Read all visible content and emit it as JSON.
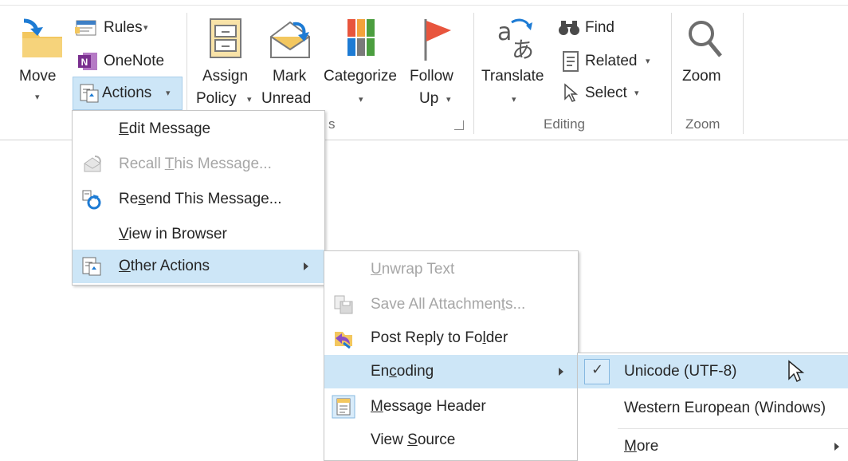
{
  "ribbon": {
    "move": {
      "label": "Move",
      "arrow": "▾",
      "icon": "move-folder-icon"
    },
    "rules": {
      "label": "Rules",
      "arrow": "▾",
      "icon": "rules-icon"
    },
    "onenote": {
      "label": "OneNote",
      "icon": "onenote-icon"
    },
    "actions": {
      "label": "Actions",
      "arrow": "▾",
      "icon": "actions-icon"
    },
    "assign_policy": {
      "line1": "Assign",
      "line2": "Policy",
      "arrow": "▾",
      "icon": "assign-policy-icon"
    },
    "mark_unread": {
      "line1": "Mark",
      "line2": "Unread",
      "icon": "mark-unread-icon"
    },
    "categorize": {
      "label": "Categorize",
      "arrow": "▾",
      "icon": "categorize-icon"
    },
    "follow_up": {
      "line1": "Follow",
      "line2": "Up",
      "arrow": "▾",
      "icon": "flag-icon"
    },
    "tags_group_label_fragment": "s",
    "translate": {
      "label": "Translate",
      "arrow": "▾",
      "icon": "translate-icon"
    },
    "find": {
      "label": "Find",
      "icon": "binoculars-icon"
    },
    "related": {
      "label": "Related",
      "arrow": "▾",
      "icon": "related-icon"
    },
    "select": {
      "label": "Select",
      "arrow": "▾",
      "icon": "select-cursor-icon"
    },
    "editing_group_label": "Editing",
    "zoom": {
      "label": "Zoom",
      "icon": "magnifier-icon"
    },
    "zoom_group_label": "Zoom"
  },
  "actions_menu": {
    "items": [
      {
        "label": "Edit Message",
        "mnemonic_index": 0,
        "enabled": true,
        "icon": ""
      },
      {
        "label": "Recall This Message...",
        "mnemonic_index": 7,
        "enabled": false,
        "icon": "recall-icon"
      },
      {
        "label": "Resend This Message...",
        "mnemonic_index": 2,
        "enabled": true,
        "icon": "resend-icon"
      },
      {
        "label": "View in Browser",
        "mnemonic_index": 0,
        "enabled": true,
        "icon": ""
      },
      {
        "label": "Other Actions",
        "mnemonic_index": 0,
        "enabled": true,
        "highlighted": true,
        "has_submenu": true,
        "icon": "other-actions-icon"
      }
    ]
  },
  "other_actions_menu": {
    "items": [
      {
        "label": "Unwrap Text",
        "mnemonic_index": 0,
        "enabled": false,
        "icon": ""
      },
      {
        "label": "Save All Attachments...",
        "mnemonic_index": 18,
        "enabled": false,
        "icon": "save-attachments-icon"
      },
      {
        "label": "Post Reply to Folder",
        "mnemonic_index": 16,
        "enabled": true,
        "icon": "post-reply-icon"
      },
      {
        "label": "Encoding",
        "mnemonic_index": 2,
        "enabled": true,
        "highlighted": true,
        "has_submenu": true,
        "icon": ""
      },
      {
        "label": "Message Header",
        "mnemonic_index": 0,
        "enabled": true,
        "icon": "message-header-icon"
      },
      {
        "label": "View Source",
        "mnemonic_index": 5,
        "enabled": true,
        "icon": ""
      }
    ]
  },
  "encoding_menu": {
    "items": [
      {
        "label": "Unicode (UTF-8)",
        "checked": true,
        "highlighted": true,
        "check_glyph": "✓"
      },
      {
        "label": "Western European (Windows)",
        "checked": false
      },
      {
        "label": "More",
        "mnemonic_index": 0,
        "has_submenu": true
      }
    ]
  },
  "colors": {
    "highlight": "#cde6f7",
    "highlight_border": "#a9cde9",
    "disabled_text": "#a6a6a6",
    "flag_red": "#e8553d",
    "folder_yellow": "#f3c75f",
    "accent_blue": "#1d7bd4"
  }
}
